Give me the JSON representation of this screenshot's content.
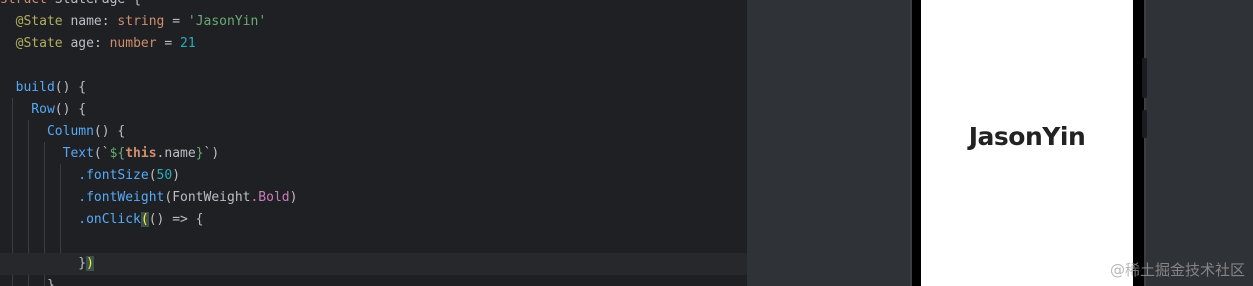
{
  "editor": {
    "lines": [
      {
        "tokens": [
          {
            "t": "struct ",
            "c": "tok-kw"
          },
          {
            "t": "StatePage ",
            "c": "tok-comp"
          },
          {
            "t": "{",
            "c": "tok-punc"
          }
        ]
      },
      {
        "tokens": [
          {
            "t": "  @State ",
            "c": "tok-ann"
          },
          {
            "t": "name",
            "c": "tok-comp"
          },
          {
            "t": ": ",
            "c": "tok-punc"
          },
          {
            "t": "string",
            "c": "tok-type"
          },
          {
            "t": " = ",
            "c": "tok-punc"
          },
          {
            "t": "'JasonYin'",
            "c": "tok-str"
          }
        ]
      },
      {
        "tokens": [
          {
            "t": "  @State ",
            "c": "tok-ann"
          },
          {
            "t": "age",
            "c": "tok-comp"
          },
          {
            "t": ": ",
            "c": "tok-punc"
          },
          {
            "t": "number",
            "c": "tok-type"
          },
          {
            "t": " = ",
            "c": "tok-punc"
          },
          {
            "t": "21",
            "c": "tok-num"
          }
        ]
      },
      {
        "tokens": []
      },
      {
        "tokens": [
          {
            "t": "  build",
            "c": "tok-fn"
          },
          {
            "t": "() {",
            "c": "tok-punc"
          }
        ]
      },
      {
        "tokens": [
          {
            "t": "    Row",
            "c": "tok-fn"
          },
          {
            "t": "() {",
            "c": "tok-punc"
          }
        ]
      },
      {
        "tokens": [
          {
            "t": "      Column",
            "c": "tok-fn"
          },
          {
            "t": "() {",
            "c": "tok-punc"
          }
        ]
      },
      {
        "tokens": [
          {
            "t": "        Text",
            "c": "tok-fn"
          },
          {
            "t": "(`",
            "c": "tok-punc"
          },
          {
            "t": "${",
            "c": "tok-str"
          },
          {
            "t": "this",
            "c": "tok-this"
          },
          {
            "t": ".name",
            "c": "tok-comp"
          },
          {
            "t": "}",
            "c": "tok-str"
          },
          {
            "t": "`)",
            "c": "tok-punc"
          }
        ]
      },
      {
        "tokens": [
          {
            "t": "          .fontSize",
            "c": "tok-method"
          },
          {
            "t": "(",
            "c": "tok-punc"
          },
          {
            "t": "50",
            "c": "tok-num"
          },
          {
            "t": ")",
            "c": "tok-punc"
          }
        ]
      },
      {
        "tokens": [
          {
            "t": "          .fontWeight",
            "c": "tok-method"
          },
          {
            "t": "(",
            "c": "tok-punc"
          },
          {
            "t": "FontWeight",
            "c": "tok-comp"
          },
          {
            "t": ".Bold",
            "c": "tok-enum"
          },
          {
            "t": ")",
            "c": "tok-punc"
          }
        ]
      },
      {
        "tokens": [
          {
            "t": "          .onClick",
            "c": "tok-method"
          },
          {
            "t": "(",
            "c": "tok-brace-hl"
          },
          {
            "t": "() => {",
            "c": "tok-punc"
          }
        ]
      },
      {
        "tokens": []
      },
      {
        "tokens": [
          {
            "t": "          }",
            "c": "tok-punc"
          },
          {
            "t": ")",
            "c": "tok-brace-hl"
          }
        ],
        "current": true
      },
      {
        "tokens": [
          {
            "t": "      }",
            "c": "tok-punc"
          }
        ]
      }
    ]
  },
  "preview": {
    "text": "JasonYin"
  },
  "watermark": "@稀土掘金技术社区"
}
